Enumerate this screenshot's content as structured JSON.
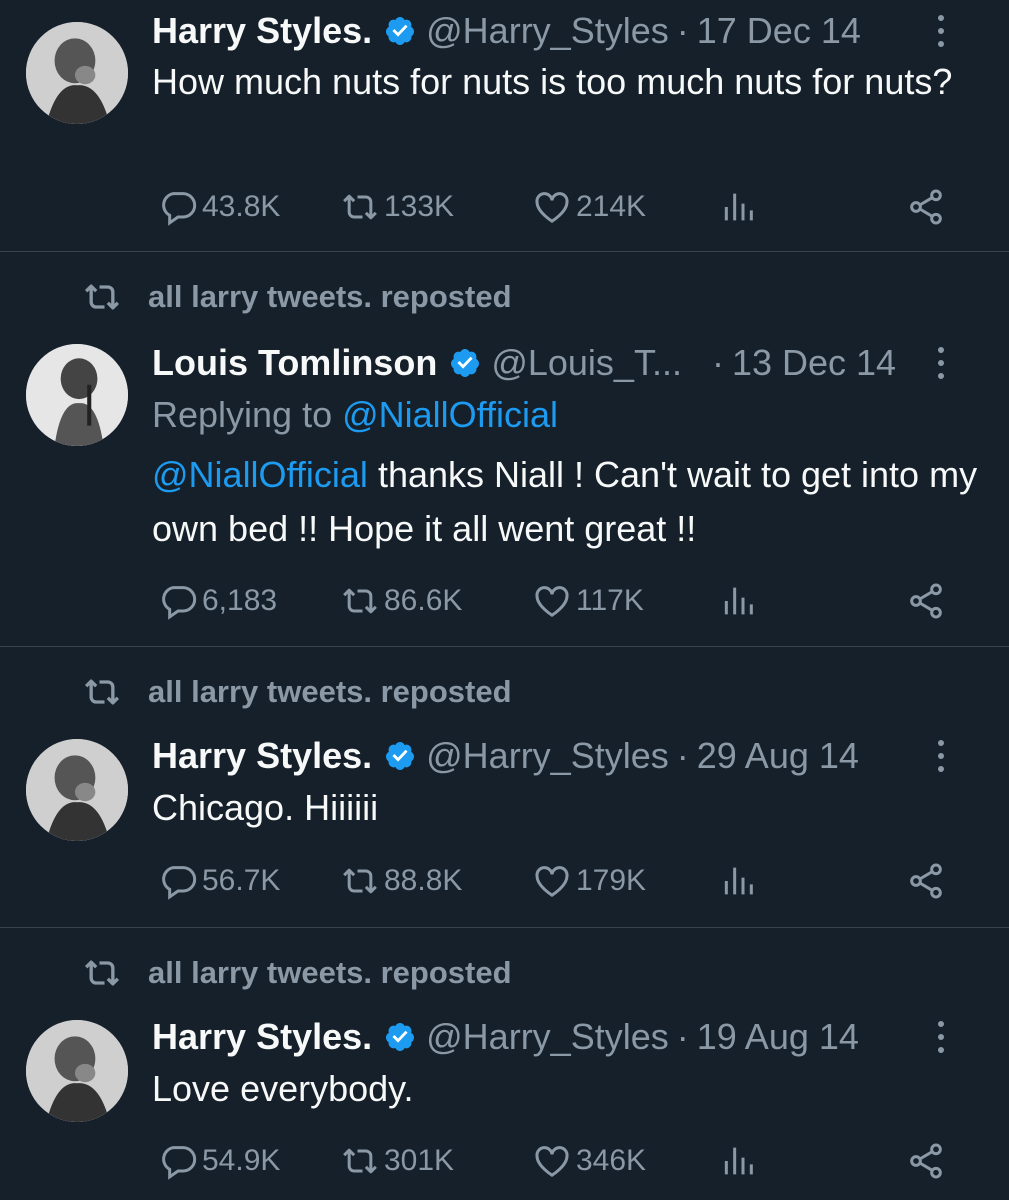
{
  "tweets": [
    {
      "repost_label": "",
      "name": "Harry Styles.",
      "handle": "@Harry_Styles",
      "separator": "·",
      "date": "17 Dec 14",
      "reply_prefix": "",
      "reply_mention": "",
      "text_mention": "",
      "text": "How much nuts for nuts is too much nuts for nuts?",
      "replies": "43.8K",
      "retweets": "133K",
      "likes": "214K"
    },
    {
      "repost_label": "all larry tweets. reposted",
      "name": "Louis Tomlinson",
      "handle": "@Louis_T...",
      "separator": "·",
      "date": "13 Dec 14",
      "reply_prefix": "Replying to ",
      "reply_mention": "@NiallOfficial",
      "text_mention": "@NiallOfficial",
      "text": " thanks Niall ! Can't wait to get into my own bed !! Hope it all went great !!",
      "replies": "6,183",
      "retweets": "86.6K",
      "likes": "117K"
    },
    {
      "repost_label": "all larry tweets. reposted",
      "name": "Harry Styles.",
      "handle": "@Harry_Styles",
      "separator": "·",
      "date": "29 Aug 14",
      "reply_prefix": "",
      "reply_mention": "",
      "text_mention": "",
      "text": "Chicago. Hiiiiii",
      "replies": "56.7K",
      "retweets": "88.8K",
      "likes": "179K"
    },
    {
      "repost_label": "all larry tweets. reposted",
      "name": "Harry Styles.",
      "handle": "@Harry_Styles",
      "separator": "·",
      "date": "19 Aug 14",
      "reply_prefix": "",
      "reply_mention": "",
      "text_mention": "",
      "text": "Love everybody.",
      "replies": "54.9K",
      "retweets": "301K",
      "likes": "346K"
    }
  ],
  "icons": {
    "repost": "retweet-icon",
    "verified": "verified-badge-icon",
    "more": "more-options-icon",
    "reply": "reply-icon",
    "retweet": "retweet-icon",
    "like": "heart-icon",
    "views": "views-icon",
    "share": "share-icon"
  },
  "colors": {
    "background": "#15202b",
    "divider": "#38444d",
    "text_primary": "#f7f9f9",
    "text_secondary": "#8b98a5",
    "accent": "#1d9bf0"
  }
}
